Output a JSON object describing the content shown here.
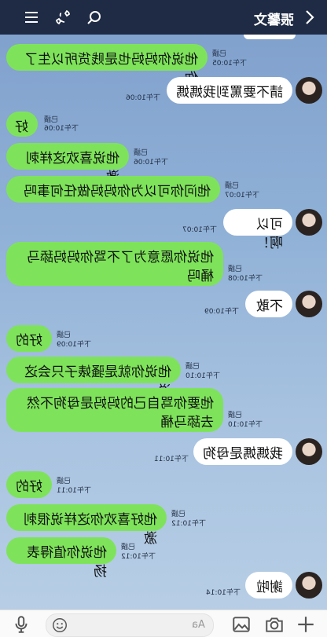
{
  "header": {
    "title": "張馨文",
    "icons": [
      "menu-icon",
      "phone-icon",
      "search-icon",
      "back-icon"
    ]
  },
  "messages": [
    {
      "side": "left",
      "text": "他说你妈妈也是贱货所以生了你",
      "read": "已讀",
      "time": "下午10:05"
    },
    {
      "side": "right",
      "text": "請不要罵到我媽媽",
      "time": "下午10:06"
    },
    {
      "side": "left",
      "text": "好",
      "read": "已讀",
      "time": "下午10:06"
    },
    {
      "side": "left",
      "text": "他说喜欢这样刺激",
      "read": "已讀",
      "time": "下午10:06"
    },
    {
      "side": "left",
      "text": "他问你可以为你妈妈做任何事吗",
      "read": "已讀",
      "time": "下午10:07"
    },
    {
      "side": "right",
      "text": "可以啊！",
      "time": "下午10:07"
    },
    {
      "side": "left",
      "text": "他说你愿意为了不骂你妈妈舔马桶吗",
      "read": "已讀",
      "time": "下午10:08"
    },
    {
      "side": "right",
      "text": "不敢",
      "time": "下午10:09"
    },
    {
      "side": "left",
      "text": "好的",
      "read": "已讀",
      "time": "下午10:09"
    },
    {
      "side": "left",
      "text": "他说你就是骚婊子只会这说",
      "read": "已讀",
      "time": "下午10:10"
    },
    {
      "side": "left",
      "text": "他要你骂自己的妈妈是母狗不然去舔马桶",
      "read": "已讀",
      "time": "下午10:10"
    },
    {
      "side": "right",
      "text": "我媽媽是母狗",
      "time": "下午10:11"
    },
    {
      "side": "left",
      "text": "好的",
      "read": "已讀",
      "time": "下午10:11"
    },
    {
      "side": "left",
      "text": "他好喜欢你这样说很刺激",
      "read": "已讀",
      "time": "下午10:12"
    },
    {
      "side": "left",
      "text": "他说你值得表扬",
      "read": "已讀",
      "time": "下午10:12"
    },
    {
      "side": "right",
      "text": "謝啦",
      "time": "下午10:14"
    }
  ],
  "input": {
    "placeholder": "Aa"
  },
  "bottom_icons": [
    "microphone-icon",
    "emoji-icon",
    "image-icon",
    "camera-icon",
    "plus-icon"
  ]
}
